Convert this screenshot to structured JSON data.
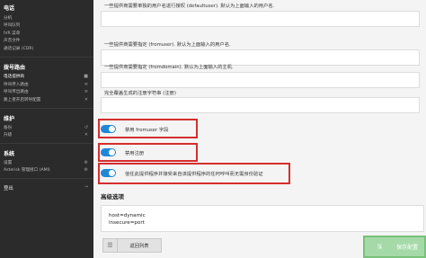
{
  "sidebar": {
    "sections": [
      {
        "title": "电话",
        "items": [
          {
            "label": "分机",
            "active": false
          },
          {
            "label": "呼叫队列",
            "active": false
          },
          {
            "label": "IVR 菜单",
            "active": false
          },
          {
            "label": "声音文件",
            "active": false
          },
          {
            "label": "通话记录 (CDR)",
            "active": false
          }
        ]
      },
      {
        "title": "拨号路由",
        "items": [
          {
            "label": "电话提供商",
            "active": true,
            "indicator": "■"
          },
          {
            "label": "呼叫传入路由",
            "active": false,
            "indicator": "≡"
          },
          {
            "label": "呼叫传出路由",
            "active": false,
            "indicator": "≡"
          },
          {
            "label": "路上者开启转呼配置",
            "active": false,
            "indicator": "✕"
          }
        ]
      },
      {
        "title": "维护",
        "items": [
          {
            "label": "备份",
            "active": false,
            "indicator": "↺"
          },
          {
            "label": "升级",
            "active": false,
            "indicator": "✕"
          }
        ]
      },
      {
        "title": "系统",
        "items": [
          {
            "label": "设置",
            "active": false,
            "indicator": "⚙"
          },
          {
            "label": "Asterisk 管理接口 (AMI)",
            "active": false,
            "indicator": "⚙"
          }
        ]
      }
    ],
    "logout": {
      "label": "登出",
      "indicator": "→"
    }
  },
  "form": {
    "help_1": "一些提供商需要单独的用户名进行授权 (defaultuser). 默认为上面输入的用户名.",
    "help_2": "一些提供商需要指定 (fromuser). 默认为上面输入的用户名.",
    "help_3": "一些提供商需要指定 (fromdomain). 默认为上面输入的主机.",
    "help_4": "完全覆盖生成的注册字符串 (注册)",
    "toggles": [
      {
        "label": "禁用 fromuser 字段",
        "on": true
      },
      {
        "label": "禁用注册",
        "on": true
      },
      {
        "label": "信任此提供程序并接受来自该提供程序的任何呼叫而无需身份验证",
        "on": true
      }
    ],
    "advanced_title": "高级选项",
    "advanced_lines": [
      "host=dynamic",
      "insecure=port"
    ]
  },
  "buttons": {
    "back": "返回列表",
    "save": "保存配置"
  },
  "colors": {
    "sidebar_bg": "#2b2b2b",
    "toggle_on": "#1e88d6",
    "highlight_box": "#d62d2d",
    "save_button": "#a6d9a8"
  }
}
